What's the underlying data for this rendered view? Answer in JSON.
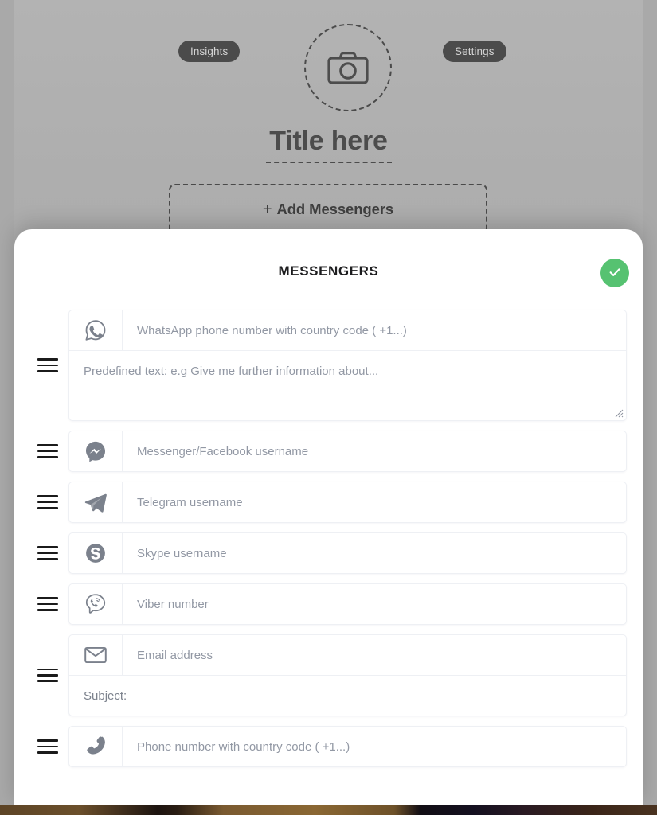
{
  "background": {
    "insights_label": "Insights",
    "settings_label": "Settings",
    "avatar_icon": "camera-icon",
    "title": "Title here",
    "add_messengers_plus": "+",
    "add_messengers_label": "Add Messengers"
  },
  "modal": {
    "title": "MESSENGERS",
    "confirm_icon": "check-icon",
    "confirm_color": "#56c271",
    "rows": [
      {
        "key": "whatsapp",
        "icon": "whatsapp-icon",
        "placeholder": "WhatsApp phone number with country code ( +1...)",
        "value": "",
        "extra_placeholder": "Predefined text: e.g Give me further information about...",
        "extra_value": ""
      },
      {
        "key": "messenger",
        "icon": "facebook-messenger-icon",
        "placeholder": "Messenger/Facebook username",
        "value": ""
      },
      {
        "key": "telegram",
        "icon": "telegram-icon",
        "placeholder": "Telegram username",
        "value": ""
      },
      {
        "key": "skype",
        "icon": "skype-icon",
        "placeholder": "Skype username",
        "value": ""
      },
      {
        "key": "viber",
        "icon": "viber-icon",
        "placeholder": "Viber number",
        "value": ""
      },
      {
        "key": "email",
        "icon": "envelope-icon",
        "placeholder": "Email address",
        "value": "",
        "extra_placeholder": "Subject:",
        "extra_value": ""
      },
      {
        "key": "phone",
        "icon": "phone-handset-icon",
        "placeholder": "Phone number with country code ( +1...)",
        "value": ""
      }
    ]
  }
}
